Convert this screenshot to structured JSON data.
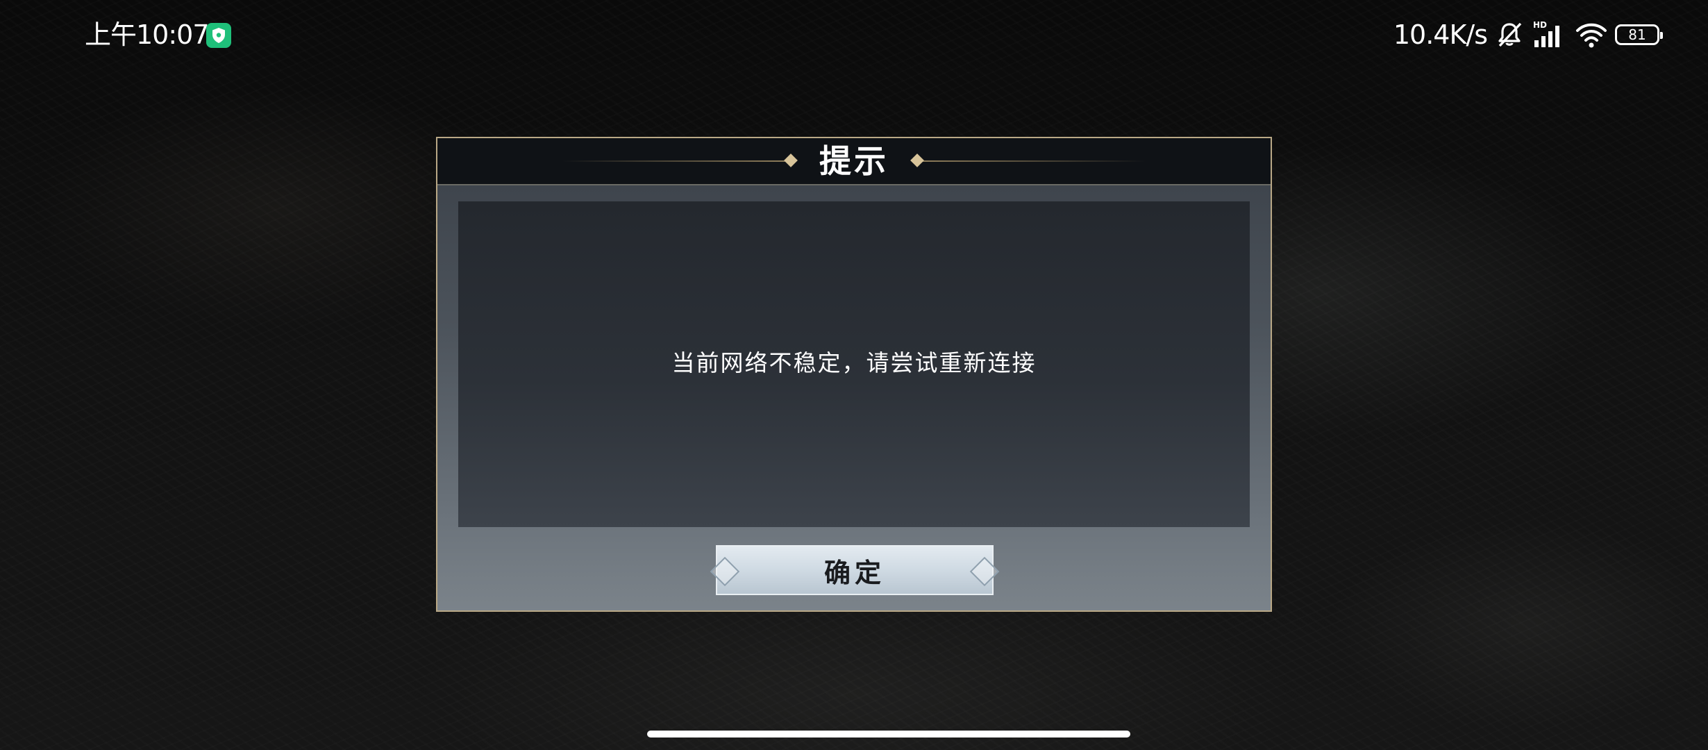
{
  "status_bar": {
    "time": "上午10:07",
    "net_speed": "10.4K/s",
    "battery_level": "81",
    "icons": [
      "shield-icon",
      "mute-bell-icon",
      "hd-signal-icon",
      "wifi-icon",
      "battery-icon"
    ]
  },
  "dialog": {
    "title": "提示",
    "message": "当前网络不稳定，请尝试重新连接",
    "confirm_label": "确定"
  },
  "colors": {
    "dialog_border": "#b9a886",
    "shield_green": "#1fc07a",
    "button_face": "#cfdae3"
  }
}
